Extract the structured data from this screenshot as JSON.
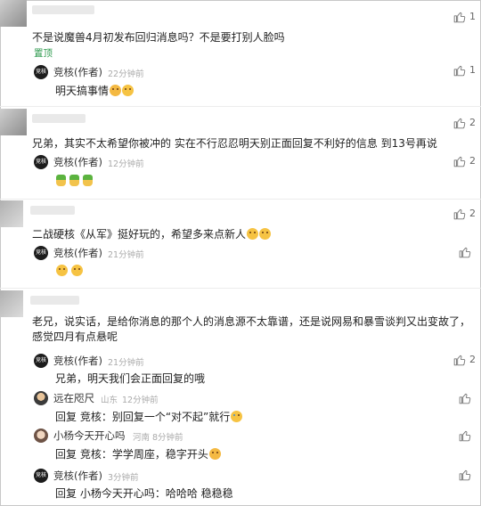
{
  "comments": [
    {
      "text": "不是说魔兽4月初发布回归消息吗？不是要打别人脸吗",
      "pinned": "置顶",
      "likes": "1",
      "replies": [
        {
          "author": "竞核(作者)",
          "avatar_text": "竞核",
          "time": "22分钟前",
          "text": "明天搞事情",
          "likes": "1",
          "emoji": [
            "grin",
            "face"
          ]
        }
      ]
    },
    {
      "text": "兄弟，其实不太希望你被冲的 实在不行忍忍明天别正面回复不利好的信息 到13号再说",
      "likes": "2",
      "replies": [
        {
          "author": "竞核(作者)",
          "avatar_text": "竞核",
          "time": "12分钟前",
          "text": "",
          "likes": "2",
          "emoji": [
            "plant",
            "plant",
            "plant"
          ]
        }
      ]
    },
    {
      "text": "二战硬核《从军》挺好玩的，希望多来点新人",
      "likes": "2",
      "emoji": [
        "face",
        "face"
      ],
      "replies": [
        {
          "author": "竞核(作者)",
          "avatar_text": "竞核",
          "time": "21分钟前",
          "text": "",
          "likes": "",
          "emoji": [
            "face",
            "face"
          ]
        }
      ]
    },
    {
      "text": "老兄，说实话，是给你消息的那个人的消息源不太靠谱，还是说网易和暴雪谈判又出变故了，感觉四月有点悬呢",
      "likes": "",
      "replies": [
        {
          "author": "竞核(作者)",
          "avatar_text": "竞核",
          "time": "21分钟前",
          "text": "兄弟，明天我们会正面回复的哦",
          "likes": "2",
          "emoji": []
        },
        {
          "author": "远在咫尺",
          "location": "山东",
          "time": "12分钟前",
          "text": "回复 竞核：别回复一个“对不起”就行",
          "likes": "",
          "emoji": [
            "cry"
          ]
        },
        {
          "author": "小杨今天开心吗",
          "location": "河南",
          "time": "8分钟前",
          "text": "回复 竞核：学学周座，稳字开头",
          "likes": "",
          "emoji": [
            "grin"
          ]
        },
        {
          "author": "竞核(作者)",
          "avatar_text": "竞核",
          "time": "3分钟前",
          "text": "回复 小杨今天开心吗：哈哈哈 稳稳稳",
          "likes": "",
          "emoji": []
        }
      ]
    }
  ]
}
